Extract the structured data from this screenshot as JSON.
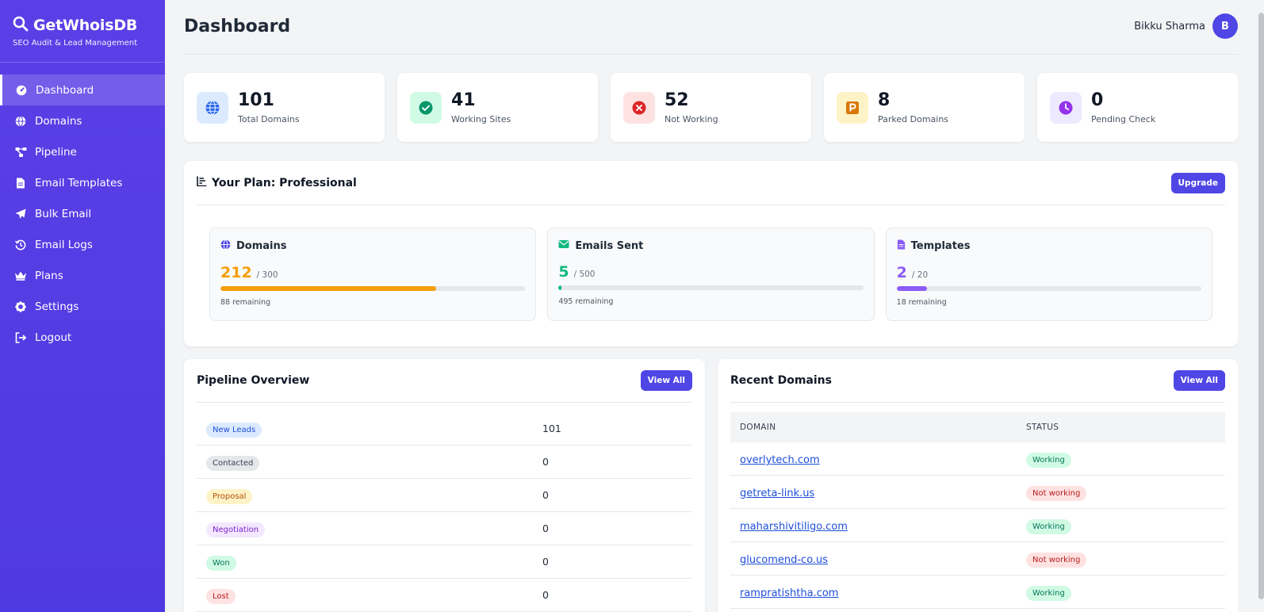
{
  "brand": {
    "title": "GetWhoisDB",
    "subtitle": "SEO Audit & Lead Management"
  },
  "sidebar": {
    "items": [
      {
        "label": "Dashboard",
        "icon": "gauge-icon",
        "active": true
      },
      {
        "label": "Domains",
        "icon": "globe-icon"
      },
      {
        "label": "Pipeline",
        "icon": "flow-icon"
      },
      {
        "label": "Email Templates",
        "icon": "file-icon"
      },
      {
        "label": "Bulk Email",
        "icon": "paper-plane-icon"
      },
      {
        "label": "Email Logs",
        "icon": "history-icon"
      },
      {
        "label": "Plans",
        "icon": "crown-icon"
      },
      {
        "label": "Settings",
        "icon": "gear-icon"
      },
      {
        "label": "Logout",
        "icon": "logout-icon"
      }
    ]
  },
  "header": {
    "title": "Dashboard",
    "user_name": "Bikku Sharma",
    "avatar_initial": "B"
  },
  "stats": [
    {
      "value": "101",
      "label": "Total Domains",
      "icon": "globe-icon",
      "color": "#2563eb",
      "bg": "#dbeafe"
    },
    {
      "value": "41",
      "label": "Working Sites",
      "icon": "check-circle-icon",
      "color": "#059669",
      "bg": "#d1fae5"
    },
    {
      "value": "52",
      "label": "Not Working",
      "icon": "x-circle-icon",
      "color": "#dc2626",
      "bg": "#fee2e2"
    },
    {
      "value": "8",
      "label": "Parked Domains",
      "icon": "parking-icon",
      "color": "#d97706",
      "bg": "#fef3c7"
    },
    {
      "value": "0",
      "label": "Pending Check",
      "icon": "clock-icon",
      "color": "#9333ea",
      "bg": "#ede9fe"
    }
  ],
  "plan": {
    "title": "Your Plan: Professional",
    "upgrade_label": "Upgrade",
    "usage": [
      {
        "name": "Domains",
        "used": "212",
        "limit": "/ 300",
        "remaining": "88 remaining",
        "fraction": 0.7067,
        "color": "#f59e0b",
        "icon": "globe-icon",
        "icon_color": "#4f46e5"
      },
      {
        "name": "Emails Sent",
        "used": "5",
        "limit": "/ 500",
        "remaining": "495 remaining",
        "fraction": 0.01,
        "color": "#10b981",
        "icon": "envelope-icon",
        "icon_color": "#10b981"
      },
      {
        "name": "Templates",
        "used": "2",
        "limit": "/ 20",
        "remaining": "18 remaining",
        "fraction": 0.1,
        "color": "#8b5cf6",
        "icon": "file-icon",
        "icon_color": "#8b5cf6"
      }
    ]
  },
  "pipeline": {
    "title": "Pipeline Overview",
    "view_all": "View All",
    "rows": [
      {
        "stage": "New Leads",
        "count": "101",
        "fg": "#1d4ed8",
        "bg": "#dbeafe"
      },
      {
        "stage": "Contacted",
        "count": "0",
        "fg": "#374151",
        "bg": "#e5e7eb"
      },
      {
        "stage": "Proposal",
        "count": "0",
        "fg": "#b45309",
        "bg": "#fef3c7"
      },
      {
        "stage": "Negotiation",
        "count": "0",
        "fg": "#7e22ce",
        "bg": "#f3e8ff"
      },
      {
        "stage": "Won",
        "count": "0",
        "fg": "#047857",
        "bg": "#d1fae5"
      },
      {
        "stage": "Lost",
        "count": "0",
        "fg": "#b91c1c",
        "bg": "#fee2e2"
      }
    ]
  },
  "recent": {
    "title": "Recent Domains",
    "view_all": "View All",
    "col_domain": "DOMAIN",
    "col_status": "STATUS",
    "rows": [
      {
        "domain": "overlytech.com",
        "status": "Working",
        "fg": "#047857",
        "bg": "#d1fae5"
      },
      {
        "domain": "getreta-link.us",
        "status": "Not working",
        "fg": "#b91c1c",
        "bg": "#fee2e2"
      },
      {
        "domain": "maharshivitiligo.com",
        "status": "Working",
        "fg": "#047857",
        "bg": "#d1fae5"
      },
      {
        "domain": "glucomend-co.us",
        "status": "Not working",
        "fg": "#b91c1c",
        "bg": "#fee2e2"
      },
      {
        "domain": "rampratishtha.com",
        "status": "Working",
        "fg": "#047857",
        "bg": "#d1fae5"
      }
    ]
  }
}
